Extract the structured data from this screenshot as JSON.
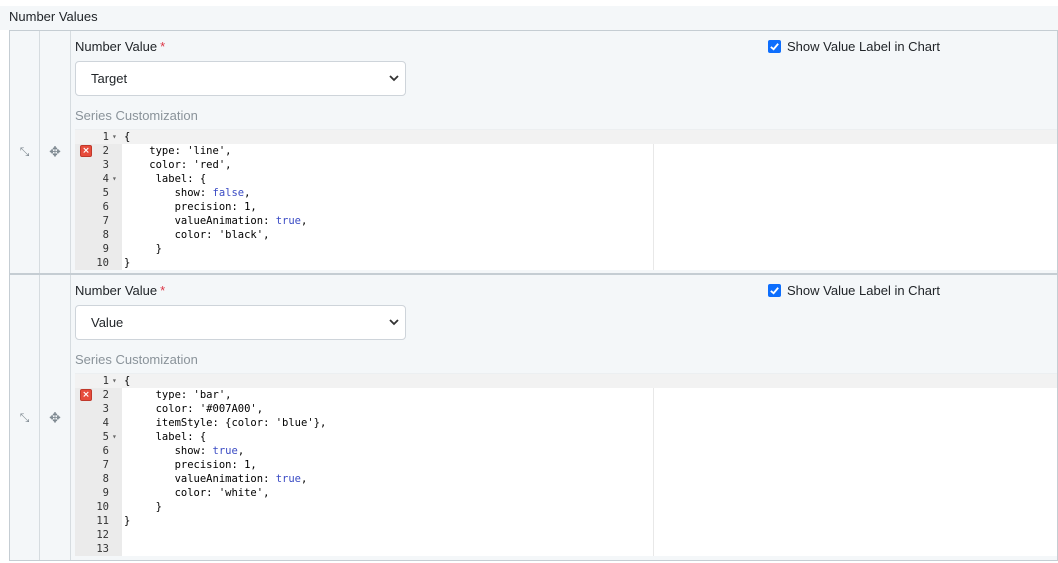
{
  "section_title": "Number Values",
  "panels": [
    {
      "number_value_label": "Number Value",
      "required_mark": "*",
      "checkbox_label": "Show Value Label in Chart",
      "checkbox_checked": true,
      "select_value": "Target",
      "series_label": "Series Customization",
      "error_line": 2,
      "lines": [
        {
          "num": "1",
          "fold": true,
          "code": "{"
        },
        {
          "num": "2",
          "fold": false,
          "code": "    type: 'line',"
        },
        {
          "num": "3",
          "fold": false,
          "code": "    color: 'red',"
        },
        {
          "num": "4",
          "fold": true,
          "code": "     label: {"
        },
        {
          "num": "5",
          "fold": false,
          "code": "        show: false,"
        },
        {
          "num": "6",
          "fold": false,
          "code": "        precision: 1,"
        },
        {
          "num": "7",
          "fold": false,
          "code": "        valueAnimation: true,"
        },
        {
          "num": "8",
          "fold": false,
          "code": "        color: 'black',"
        },
        {
          "num": "9",
          "fold": false,
          "code": "     }"
        },
        {
          "num": "10",
          "fold": false,
          "code": "}"
        }
      ]
    },
    {
      "number_value_label": "Number Value",
      "required_mark": "*",
      "checkbox_label": "Show Value Label in Chart",
      "checkbox_checked": true,
      "select_value": "Value",
      "series_label": "Series Customization",
      "error_line": 2,
      "lines": [
        {
          "num": "1",
          "fold": true,
          "code": "{"
        },
        {
          "num": "2",
          "fold": false,
          "code": "     type: 'bar',"
        },
        {
          "num": "3",
          "fold": false,
          "code": "     color: '#007A00',"
        },
        {
          "num": "4",
          "fold": false,
          "code": "     itemStyle: {color: 'blue'},"
        },
        {
          "num": "5",
          "fold": true,
          "code": "     label: {"
        },
        {
          "num": "6",
          "fold": false,
          "code": "        show: true,"
        },
        {
          "num": "7",
          "fold": false,
          "code": "        precision: 1,"
        },
        {
          "num": "8",
          "fold": false,
          "code": "        valueAnimation: true,"
        },
        {
          "num": "9",
          "fold": false,
          "code": "        color: 'white',"
        },
        {
          "num": "10",
          "fold": false,
          "code": "     }"
        },
        {
          "num": "11",
          "fold": false,
          "code": "}"
        },
        {
          "num": "12",
          "fold": false,
          "code": ""
        },
        {
          "num": "13",
          "fold": false,
          "code": ""
        }
      ]
    }
  ],
  "icons": {
    "drag_handle": "collapse-arrows-icon",
    "move": "move-arrows-icon",
    "error": "error-x-icon",
    "checkbox": "checkmark-icon",
    "chevron": "chevron-down-icon"
  }
}
